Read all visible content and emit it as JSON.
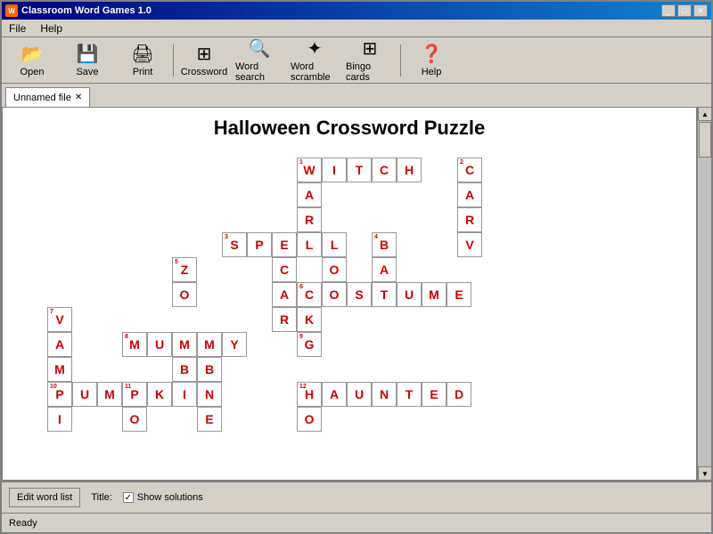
{
  "window": {
    "title": "Classroom Word Games 1.0",
    "tab_label": "Unnamed file"
  },
  "menu": {
    "items": [
      "File",
      "Help"
    ]
  },
  "toolbar": {
    "buttons": [
      {
        "label": "Open",
        "icon": "📂"
      },
      {
        "label": "Save",
        "icon": "💾"
      },
      {
        "label": "Print",
        "icon": "🖨"
      },
      {
        "label": "Crossword",
        "icon": "⊞"
      },
      {
        "label": "Word search",
        "icon": "🔍"
      },
      {
        "label": "Word scramble",
        "icon": "✦"
      },
      {
        "label": "Bingo cards",
        "icon": "⊞"
      },
      {
        "label": "Help",
        "icon": "❓"
      }
    ]
  },
  "puzzle": {
    "title": "Halloween Crossword Puzzle"
  },
  "bottom": {
    "edit_word_list_label": "Edit word list",
    "title_label": "Title:",
    "show_solutions_label": "Show solutions"
  },
  "status": {
    "text": "Ready"
  }
}
